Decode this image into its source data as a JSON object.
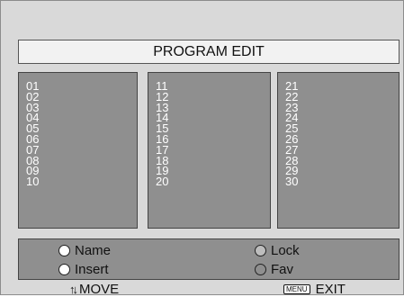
{
  "title": "PROGRAM EDIT",
  "columns": [
    [
      "01",
      "02",
      "03",
      "04",
      "05",
      "06",
      "07",
      "08",
      "09",
      "10"
    ],
    [
      "11",
      "12",
      "13",
      "14",
      "15",
      "16",
      "17",
      "18",
      "19",
      "20"
    ],
    [
      "21",
      "22",
      "23",
      "24",
      "25",
      "26",
      "27",
      "28",
      "29",
      "30"
    ]
  ],
  "options": {
    "name": "Name",
    "insert": "Insert",
    "lock": "Lock",
    "fav": "Fav"
  },
  "footer": {
    "move_label": "MOVE",
    "menu_key": "MENU",
    "exit_label": "EXIT"
  }
}
